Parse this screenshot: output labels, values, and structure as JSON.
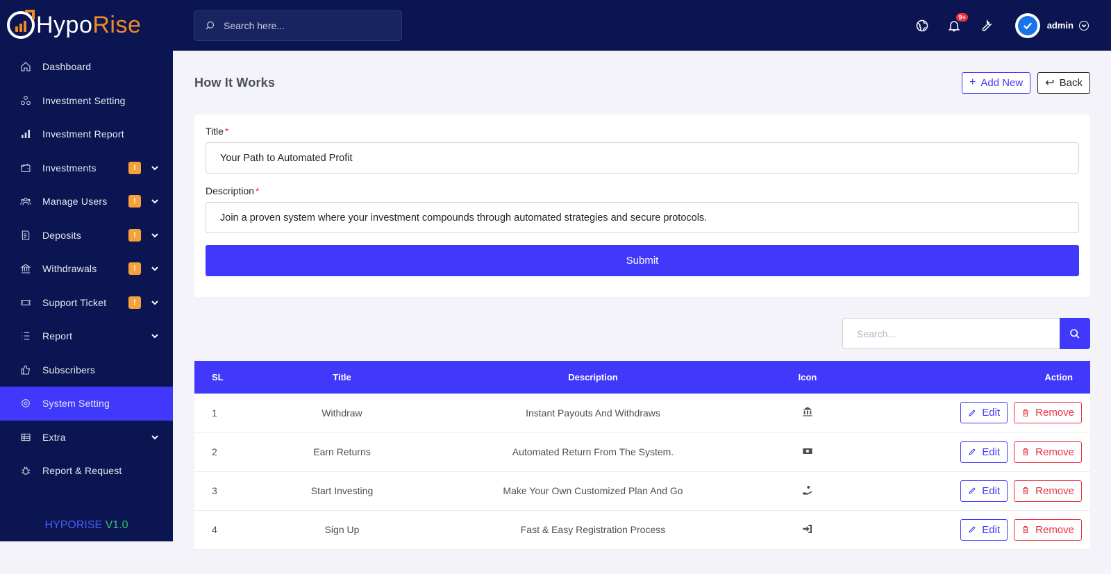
{
  "brand": {
    "part1": "Hypo",
    "part2": "Rise"
  },
  "sidebar": {
    "items": [
      {
        "label": "Dashboard",
        "icon": "home-icon"
      },
      {
        "label": "Investment Setting",
        "icon": "nodes-icon"
      },
      {
        "label": "Investment Report",
        "icon": "bar-chart-icon"
      },
      {
        "label": "Investments",
        "icon": "wallet-icon",
        "badge": "!"
      },
      {
        "label": "Manage Users",
        "icon": "users-icon",
        "badge": "!"
      },
      {
        "label": "Deposits",
        "icon": "receipt-icon",
        "badge": "!"
      },
      {
        "label": "Withdrawals",
        "icon": "bank-icon",
        "badge": "!"
      },
      {
        "label": "Support Ticket",
        "icon": "ticket-icon",
        "badge": "!"
      },
      {
        "label": "Report",
        "icon": "list-icon"
      },
      {
        "label": "Subscribers",
        "icon": "thumb-up-icon"
      },
      {
        "label": "System Setting",
        "icon": "gear-icon"
      },
      {
        "label": "Extra",
        "icon": "table-icon"
      },
      {
        "label": "Report & Request",
        "icon": "bug-icon"
      }
    ],
    "version_name": "HYPORISE",
    "version_number": "V1.0"
  },
  "header": {
    "search_placeholder": "Search here...",
    "notification_count": "9+",
    "user_name": "admin"
  },
  "page": {
    "title": "How It Works",
    "add_new_label": "Add New",
    "back_label": "Back"
  },
  "form": {
    "title_label": "Title",
    "title_value": "Your Path to Automated Profit",
    "description_label": "Description",
    "description_value": "Join a proven system where your investment compounds through automated strategies and secure protocols.",
    "required_mark": "*",
    "submit_label": "Submit"
  },
  "table": {
    "search_placeholder": "Search...",
    "headers": {
      "sl": "SL",
      "title": "Title",
      "description": "Description",
      "icon": "Icon",
      "action": "Action"
    },
    "edit_label": "Edit",
    "remove_label": "Remove",
    "rows": [
      {
        "sl": "1",
        "title": "Withdraw",
        "description": "Instant Payouts And Withdraws",
        "icon": "bank-icon"
      },
      {
        "sl": "2",
        "title": "Earn Returns",
        "description": "Automated Return From The System.",
        "icon": "money-icon"
      },
      {
        "sl": "3",
        "title": "Start Investing",
        "description": "Make Your Own Customized Plan And Go",
        "icon": "hand-coin-icon"
      },
      {
        "sl": "4",
        "title": "Sign Up",
        "description": "Fast & Easy Registration Process",
        "icon": "sign-in-icon"
      }
    ]
  },
  "colors": {
    "primary": "#4038fb",
    "sidebar": "#0a1551",
    "badge": "#f7a13c",
    "danger": "#e8313c"
  }
}
